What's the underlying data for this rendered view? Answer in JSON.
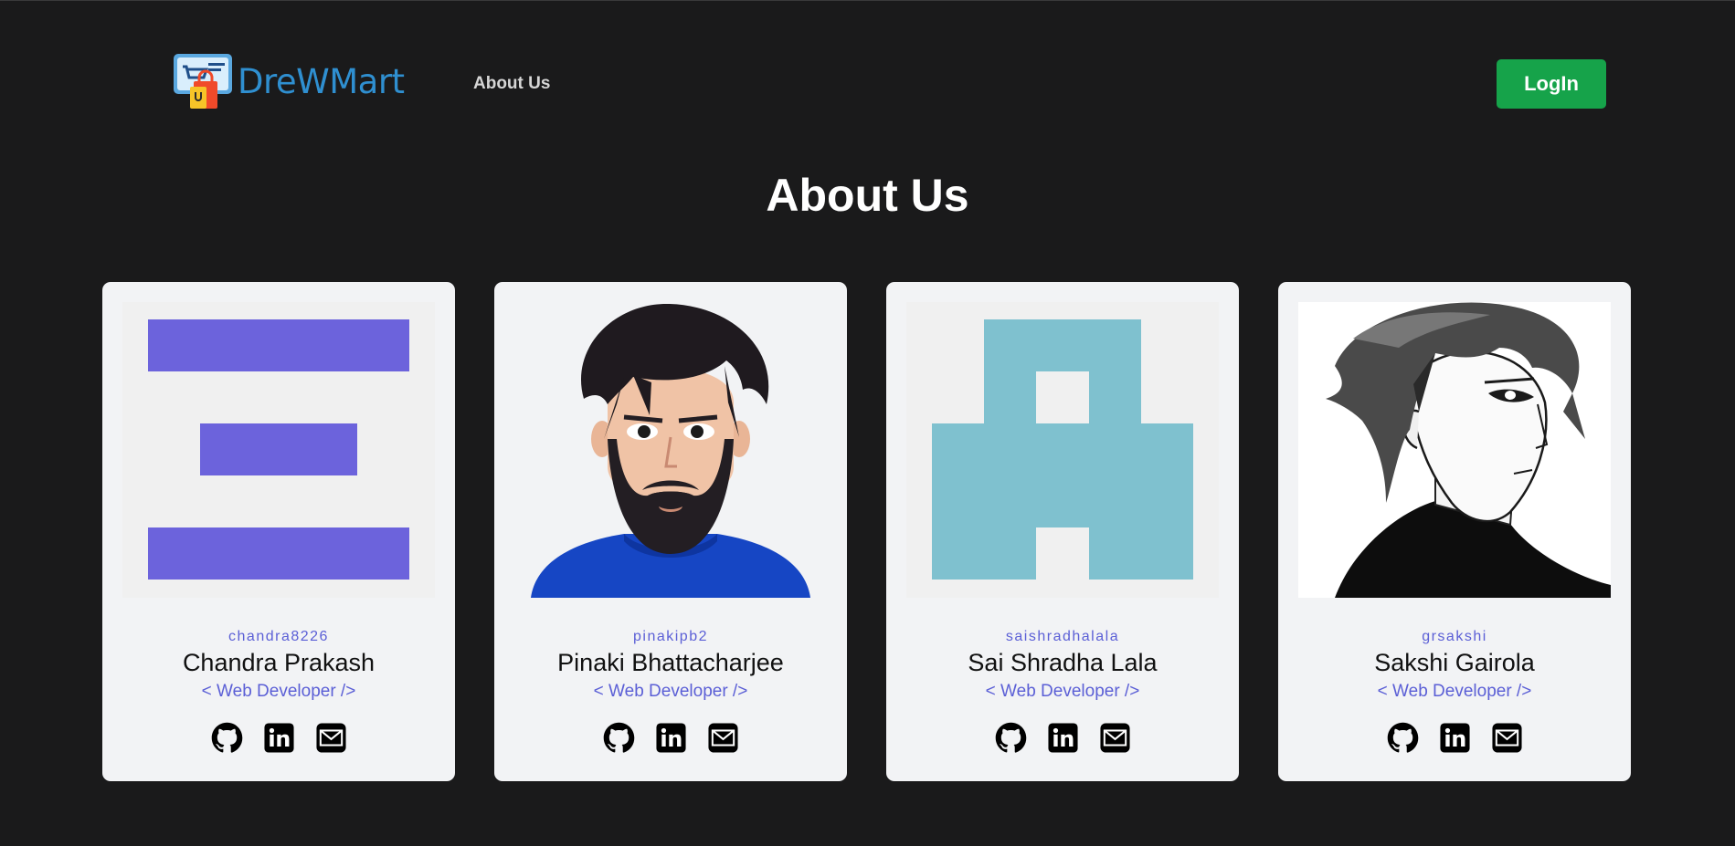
{
  "brand": {
    "name": "DreWMart",
    "color": "#2f8fd0"
  },
  "nav": {
    "about_label": "About Us"
  },
  "header": {
    "login_label": "LogIn",
    "login_color": "#16a34a"
  },
  "page": {
    "title": "About Us"
  },
  "members": [
    {
      "username": "chandra8226",
      "name": "Chandra Prakash",
      "role": "< Web Developer />",
      "avatar": "identicon-purple"
    },
    {
      "username": "pinakipb2",
      "name": "Pinaki Bhattacharjee",
      "role": "< Web Developer />",
      "avatar": "cartoon-bearded-man"
    },
    {
      "username": "saishradhalala",
      "name": "Sai Shradha Lala",
      "role": "< Web Developer />",
      "avatar": "identicon-teal"
    },
    {
      "username": "grsakshi",
      "name": "Sakshi Gairola",
      "role": "< Web Developer />",
      "avatar": "manga-sketch-man"
    }
  ],
  "social_icons": [
    "github-icon",
    "linkedin-icon",
    "mail-icon"
  ],
  "colors": {
    "background": "#1a1a1b",
    "card": "#f2f3f5",
    "accent": "#5b5fd6",
    "identicon_purple": "#6c63dc",
    "identicon_teal": "#7fc1cf"
  }
}
